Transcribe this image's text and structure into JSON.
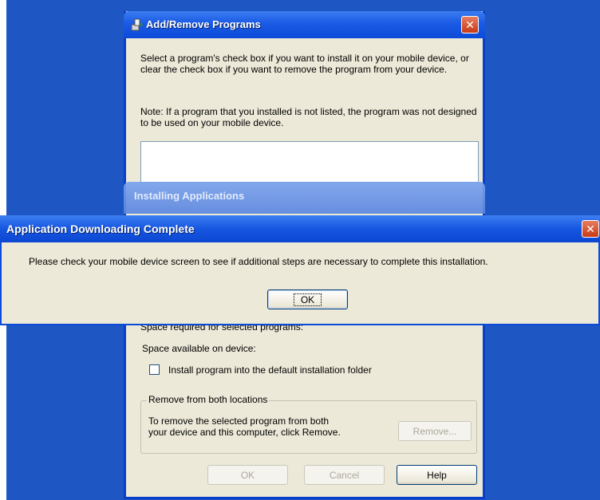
{
  "add_remove_window": {
    "title": "Add/Remove Programs",
    "description": "Select a program's check box if you want to install it on your mobile device, or clear the check box if you want to remove the program from your device.",
    "note": "Note:  If a program that you installed is not listed, the program was not designed to be used on your mobile device.",
    "space_required_label": "Space required for selected programs:",
    "space_available_label": "Space available on device:",
    "install_default_folder_label": "Install program into the default installation folder",
    "install_default_folder_checked": false,
    "remove_group": {
      "legend": "Remove from both locations",
      "text_line1": "To remove the selected program from both",
      "text_line2": "your device and this computer, click Remove.",
      "remove_button": "Remove..."
    },
    "buttons": {
      "ok": "OK",
      "cancel": "Cancel",
      "help": "Help"
    }
  },
  "installing_window": {
    "title": "Installing Applications"
  },
  "download_complete_dialog": {
    "title": "Application Downloading Complete",
    "message": "Please check your mobile device screen to see if additional steps are necessary to complete this installation.",
    "ok_button": "OK"
  },
  "icons": {
    "window_icon": "add-remove-programs-icon",
    "close": "close-icon"
  },
  "colors": {
    "desktop": "#1e56c3",
    "titlebar": "#0b4bd8",
    "dialog_face": "#ece9d8",
    "close_button": "#c93a16"
  }
}
